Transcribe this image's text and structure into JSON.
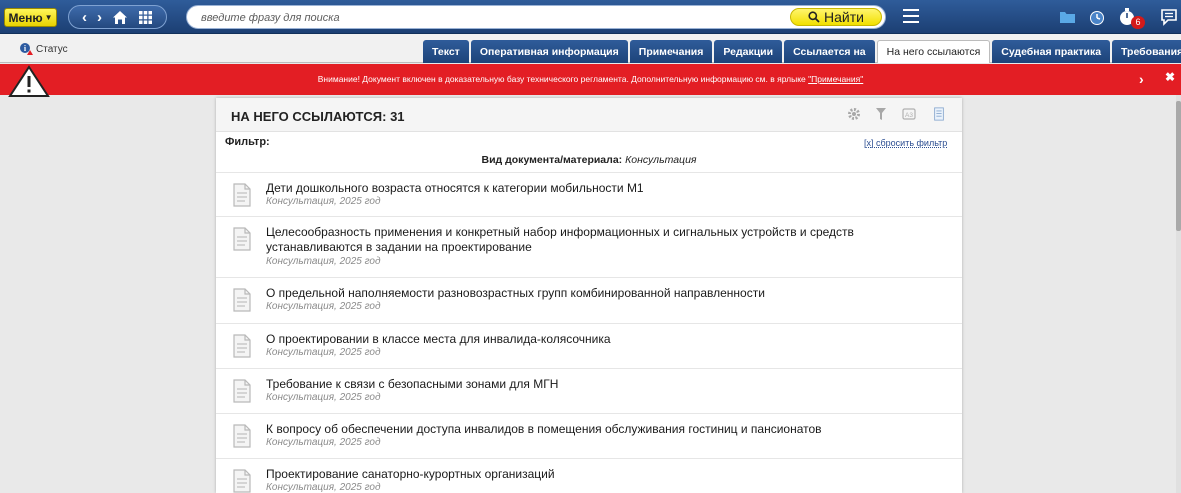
{
  "topbar": {
    "menu_label": "Меню",
    "search_placeholder": "введите фразу для поиска",
    "find_label": "Найти",
    "notification_count": "6"
  },
  "subbar": {
    "status_label": "Статус",
    "tabs": [
      {
        "label": "Текст",
        "active": false
      },
      {
        "label": "Оперативная информация",
        "active": false
      },
      {
        "label": "Примечания",
        "active": false
      },
      {
        "label": "Редакции",
        "active": false
      },
      {
        "label": "Ссылается на",
        "active": false
      },
      {
        "label": "На него ссылаются",
        "active": true
      },
      {
        "label": "Судебная практика",
        "active": false
      },
      {
        "label": "Требования",
        "active": false
      }
    ]
  },
  "warning": {
    "text": "Внимание! Документ включен в доказательную базу технического регламента. Дополнительную информацию см. в ярлыке ",
    "link": "\"Примечания\""
  },
  "panel": {
    "title": "НА НЕГО ССЫЛАЮТСЯ: 31",
    "filter_label": "Фильтр:",
    "reset_label": "[x] сбросить фильтр",
    "filter_key": "Вид документа/материала:",
    "filter_value": "Консультация",
    "items": [
      {
        "title": "Дети дошкольного возраста относятся к категории мобильности М1",
        "meta": "Консультация, 2025 год"
      },
      {
        "title": "Целесообразность применения и конкретный набор информационных и сигнальных устройств и средств устанавливаются в задании на проектирование",
        "meta": "Консультация, 2025 год"
      },
      {
        "title": "О предельной наполняемости разновозрастных групп комбинированной направленности",
        "meta": "Консультация, 2025 год"
      },
      {
        "title": "О проектировании в классе места для инвалида-колясочника",
        "meta": "Консультация, 2025 год"
      },
      {
        "title": "Требование к связи с безопасными зонами для МГН",
        "meta": "Консультация, 2025 год"
      },
      {
        "title": "К вопросу об обеспечении доступа инвалидов в помещения обслуживания гостиниц и пансионатов",
        "meta": "Консультация, 2025 год"
      },
      {
        "title": "Проектирование санаторно-курортных организаций",
        "meta": "Консультация, 2025 год"
      }
    ]
  },
  "colors": {
    "topbar": "#24497f",
    "accent_yellow": "#f2e000",
    "warning_red": "#e31e24",
    "link_blue": "#2b4e92"
  }
}
